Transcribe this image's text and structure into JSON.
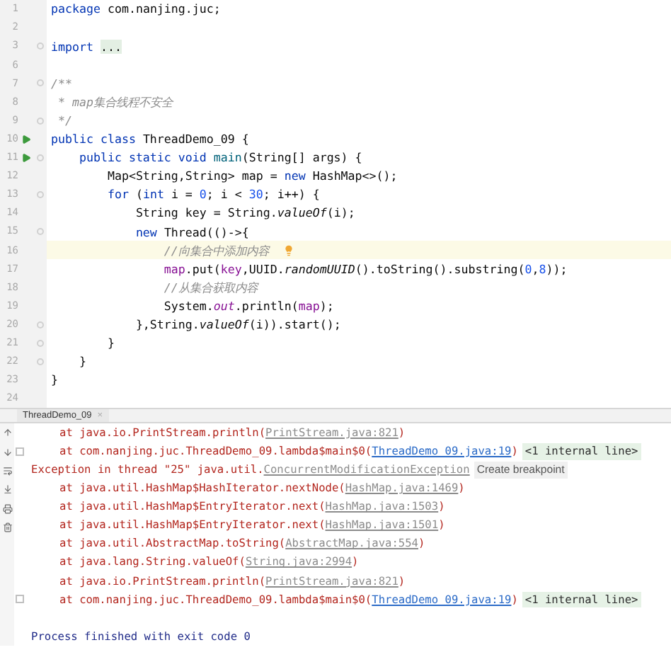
{
  "editor": {
    "lines": [
      {
        "number": "1",
        "run": false,
        "fold": false,
        "current": false,
        "tokens": [
          {
            "kind": "keyword",
            "text": "package "
          },
          {
            "kind": "plain",
            "text": "com.nanjing.juc;"
          }
        ]
      },
      {
        "number": "2",
        "run": false,
        "fold": false,
        "current": false
      },
      {
        "number": "3",
        "run": false,
        "fold": true,
        "current": false,
        "tokens": [
          {
            "kind": "keyword",
            "text": "import "
          },
          {
            "kind": "folded",
            "text": "..."
          }
        ]
      },
      {
        "number": "6",
        "run": false,
        "fold": false,
        "current": false
      },
      {
        "number": "7",
        "run": false,
        "fold": true,
        "current": false,
        "tokens": [
          {
            "kind": "comment",
            "text": "/**"
          }
        ]
      },
      {
        "number": "8",
        "run": false,
        "fold": false,
        "current": false,
        "tokens": [
          {
            "kind": "comment",
            "text": " * map集合线程不安全"
          }
        ]
      },
      {
        "number": "9",
        "run": false,
        "fold": true,
        "current": false,
        "tokens": [
          {
            "kind": "comment",
            "text": " */"
          }
        ]
      },
      {
        "number": "10",
        "run": true,
        "fold": false,
        "current": false,
        "tokens": [
          {
            "kind": "keyword",
            "text": "public class "
          },
          {
            "kind": "plain",
            "text": "ThreadDemo_09 {"
          }
        ]
      },
      {
        "number": "11",
        "run": true,
        "fold": true,
        "current": false,
        "tokens": [
          {
            "kind": "keyword",
            "text": "    public static void "
          },
          {
            "kind": "method",
            "text": "main"
          },
          {
            "kind": "plain",
            "text": "(String[] args) {"
          }
        ]
      },
      {
        "number": "12",
        "run": false,
        "fold": false,
        "current": false,
        "tokens": [
          {
            "kind": "plain",
            "text": "        Map<String,String> map = "
          },
          {
            "kind": "keyword",
            "text": "new "
          },
          {
            "kind": "plain",
            "text": "HashMap<>();"
          }
        ]
      },
      {
        "number": "13",
        "run": false,
        "fold": true,
        "current": false,
        "tokens": [
          {
            "kind": "keyword",
            "text": "        for "
          },
          {
            "kind": "plain",
            "text": "("
          },
          {
            "kind": "keyword",
            "text": "int "
          },
          {
            "kind": "plain",
            "text": "i = "
          },
          {
            "kind": "number",
            "text": "0"
          },
          {
            "kind": "plain",
            "text": "; i < "
          },
          {
            "kind": "number",
            "text": "30"
          },
          {
            "kind": "plain",
            "text": "; i++) {"
          }
        ]
      },
      {
        "number": "14",
        "run": false,
        "fold": false,
        "current": false,
        "tokens": [
          {
            "kind": "plain",
            "text": "            String key = String."
          },
          {
            "kind": "static",
            "text": "valueOf"
          },
          {
            "kind": "plain",
            "text": "(i);"
          }
        ]
      },
      {
        "number": "15",
        "run": false,
        "fold": true,
        "current": false,
        "tokens": [
          {
            "kind": "keyword",
            "text": "            new "
          },
          {
            "kind": "plain",
            "text": "Thread(()->{"
          }
        ]
      },
      {
        "number": "16",
        "run": false,
        "fold": false,
        "current": true,
        "tokens": [
          {
            "kind": "comment",
            "text": "                //向集合中添加内容"
          }
        ]
      },
      {
        "number": "17",
        "run": false,
        "fold": false,
        "current": false,
        "tokens": [
          {
            "kind": "field",
            "text": "                map"
          },
          {
            "kind": "plain",
            "text": ".put("
          },
          {
            "kind": "field",
            "text": "key"
          },
          {
            "kind": "plain",
            "text": ",UUID."
          },
          {
            "kind": "static",
            "text": "randomUUID"
          },
          {
            "kind": "plain",
            "text": "().toString().substring("
          },
          {
            "kind": "number",
            "text": "0"
          },
          {
            "kind": "plain",
            "text": ","
          },
          {
            "kind": "number",
            "text": "8"
          },
          {
            "kind": "plain",
            "text": "));"
          }
        ]
      },
      {
        "number": "18",
        "run": false,
        "fold": false,
        "current": false,
        "tokens": [
          {
            "kind": "comment",
            "text": "                //从集合获取内容"
          }
        ]
      },
      {
        "number": "19",
        "run": false,
        "fold": false,
        "current": false,
        "tokens": [
          {
            "kind": "plain",
            "text": "                System."
          },
          {
            "kind": "staticfield",
            "text": "out"
          },
          {
            "kind": "plain",
            "text": ".println("
          },
          {
            "kind": "field",
            "text": "map"
          },
          {
            "kind": "plain",
            "text": ");"
          }
        ]
      },
      {
        "number": "20",
        "run": false,
        "fold": true,
        "current": false,
        "tokens": [
          {
            "kind": "plain",
            "text": "            },String."
          },
          {
            "kind": "static",
            "text": "valueOf"
          },
          {
            "kind": "plain",
            "text": "(i)).start();"
          }
        ]
      },
      {
        "number": "21",
        "run": false,
        "fold": true,
        "current": false,
        "tokens": [
          {
            "kind": "plain",
            "text": "        }"
          }
        ]
      },
      {
        "number": "22",
        "run": false,
        "fold": true,
        "current": false,
        "tokens": [
          {
            "kind": "plain",
            "text": "    }"
          }
        ]
      },
      {
        "number": "23",
        "run": false,
        "fold": false,
        "current": false,
        "tokens": [
          {
            "kind": "plain",
            "text": "}"
          }
        ]
      },
      {
        "number": "24",
        "run": false,
        "fold": false,
        "current": false
      }
    ]
  },
  "run_tab": {
    "label": "ThreadDemo_09",
    "close": "×"
  },
  "console": {
    "lines": [
      {
        "kind": "frame",
        "fold_marker": false,
        "parts": [
          {
            "kind": "text",
            "text": "at java.io.PrintStream.println("
          },
          {
            "kind": "link",
            "text": "PrintStream.java:821"
          },
          {
            "kind": "text",
            "text": ")"
          }
        ]
      },
      {
        "kind": "frame",
        "fold_marker": true,
        "parts": [
          {
            "kind": "text",
            "text": "at com.nanjing.juc.ThreadDemo_09.lambda$main$0("
          },
          {
            "kind": "source",
            "text": "ThreadDemo_09.java:19"
          },
          {
            "kind": "text",
            "text": ")"
          },
          {
            "kind": "chip",
            "text": "<1 internal line>"
          }
        ]
      },
      {
        "kind": "exception",
        "fold_marker": false,
        "parts": [
          {
            "kind": "text",
            "text": "Exception in thread \"25\" java.util."
          },
          {
            "kind": "link",
            "text": "ConcurrentModificationException"
          },
          {
            "kind": "action",
            "text": "Create breakpoint"
          }
        ]
      },
      {
        "kind": "frame",
        "fold_marker": false,
        "parts": [
          {
            "kind": "text",
            "text": "at java.util.HashMap$HashIterator.nextNode("
          },
          {
            "kind": "link",
            "text": "HashMap.java:1469"
          },
          {
            "kind": "text",
            "text": ")"
          }
        ]
      },
      {
        "kind": "frame",
        "fold_marker": false,
        "parts": [
          {
            "kind": "text",
            "text": "at java.util.HashMap$EntryIterator.next("
          },
          {
            "kind": "link",
            "text": "HashMap.java:1503"
          },
          {
            "kind": "text",
            "text": ")"
          }
        ]
      },
      {
        "kind": "frame",
        "fold_marker": false,
        "parts": [
          {
            "kind": "text",
            "text": "at java.util.HashMap$EntryIterator.next("
          },
          {
            "kind": "link",
            "text": "HashMap.java:1501"
          },
          {
            "kind": "text",
            "text": ")"
          }
        ]
      },
      {
        "kind": "frame",
        "fold_marker": false,
        "parts": [
          {
            "kind": "text",
            "text": "at java.util.AbstractMap.toString("
          },
          {
            "kind": "link",
            "text": "AbstractMap.java:554"
          },
          {
            "kind": "text",
            "text": ")"
          }
        ]
      },
      {
        "kind": "frame",
        "fold_marker": false,
        "parts": [
          {
            "kind": "text",
            "text": "at java.lang.String.valueOf("
          },
          {
            "kind": "link",
            "text": "String.java:2994"
          },
          {
            "kind": "text",
            "text": ")"
          }
        ]
      },
      {
        "kind": "frame",
        "fold_marker": false,
        "parts": [
          {
            "kind": "text",
            "text": "at java.io.PrintStream.println("
          },
          {
            "kind": "link",
            "text": "PrintStream.java:821"
          },
          {
            "kind": "text",
            "text": ")"
          }
        ]
      },
      {
        "kind": "frame",
        "fold_marker": true,
        "parts": [
          {
            "kind": "text",
            "text": "at com.nanjing.juc.ThreadDemo_09.lambda$main$0("
          },
          {
            "kind": "source",
            "text": "ThreadDemo_09.java:19"
          },
          {
            "kind": "text",
            "text": ")"
          },
          {
            "kind": "chip",
            "text": "<1 internal line>"
          }
        ]
      },
      {
        "kind": "blank",
        "fold_marker": false
      },
      {
        "kind": "status",
        "fold_marker": false,
        "parts": [
          {
            "kind": "text",
            "text": "Process finished with exit code 0"
          }
        ]
      }
    ]
  }
}
